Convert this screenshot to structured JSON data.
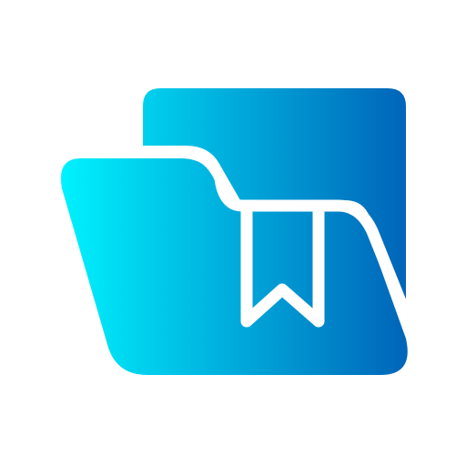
{
  "icon": {
    "name": "bookmark-folder-icon",
    "colors": {
      "gradient_start": "#00F4FF",
      "gradient_end": "#0063B8",
      "stroke": "#FFFFFF",
      "background": "#FFFFFF"
    }
  }
}
